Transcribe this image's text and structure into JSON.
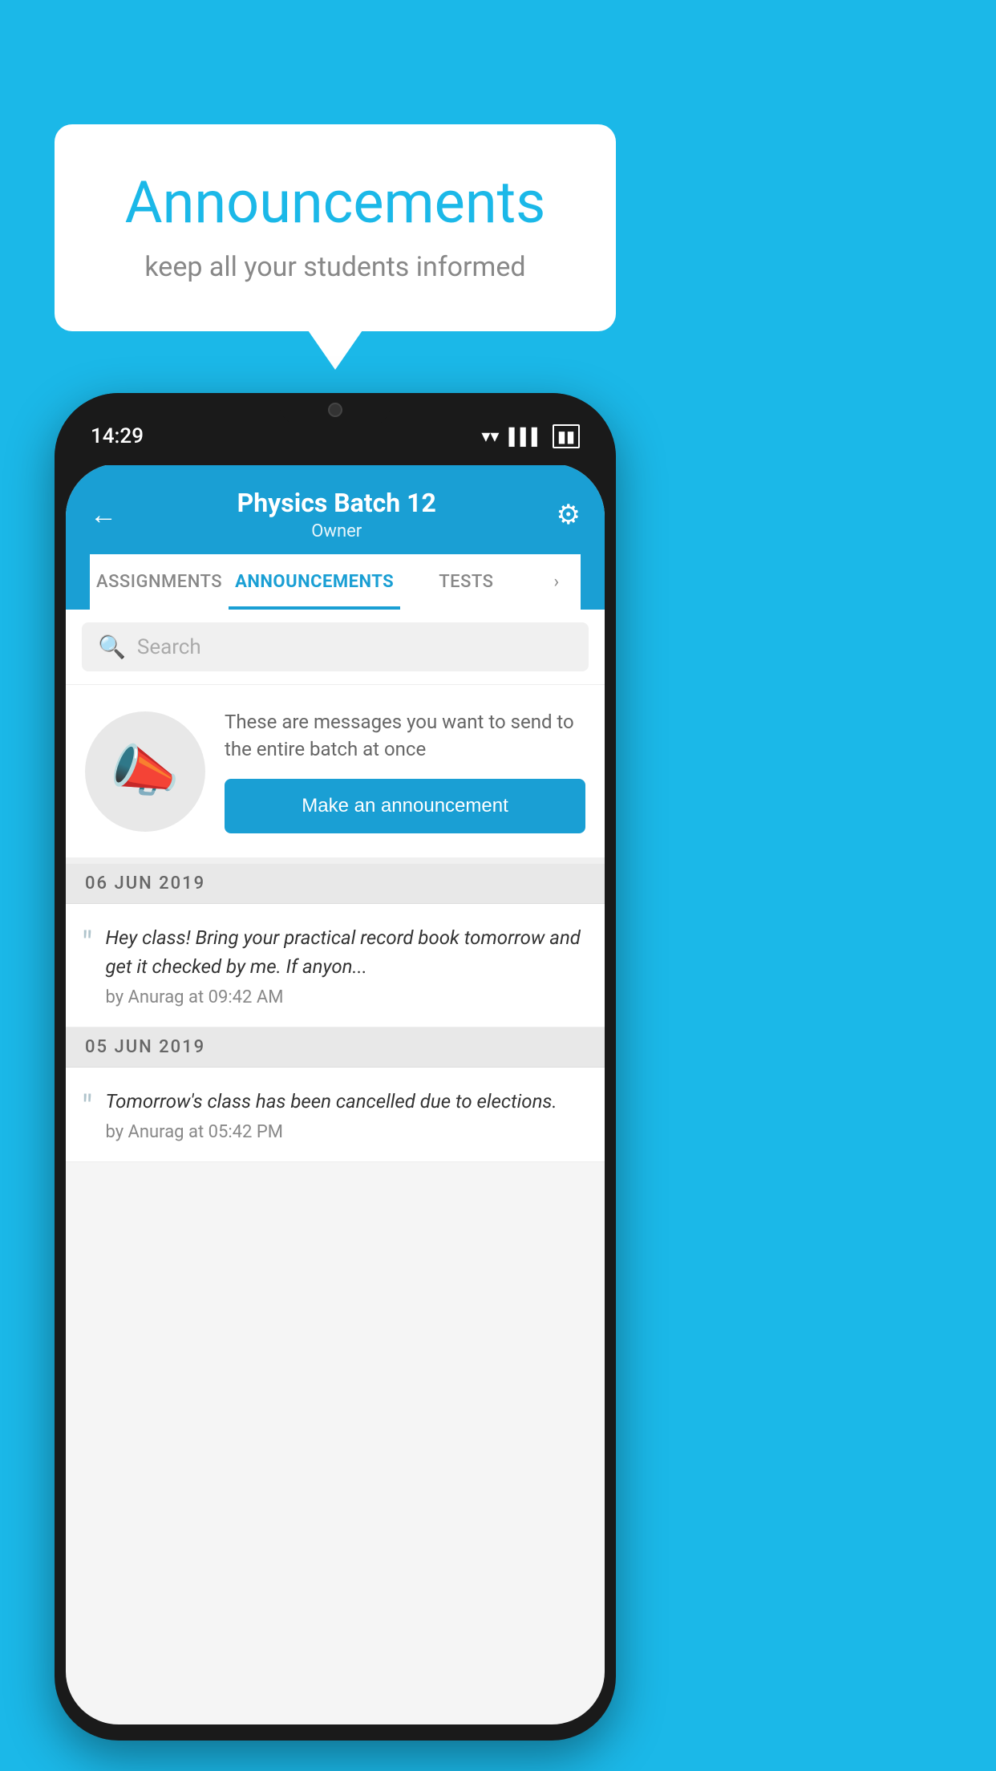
{
  "background": {
    "color": "#1BB8E8"
  },
  "speech_bubble": {
    "title": "Announcements",
    "subtitle": "keep all your students informed"
  },
  "phone": {
    "status_bar": {
      "time": "14:29"
    },
    "header": {
      "title": "Physics Batch 12",
      "subtitle": "Owner",
      "back_label": "←",
      "gear_label": "⚙"
    },
    "tabs": [
      {
        "label": "ASSIGNMENTS",
        "active": false
      },
      {
        "label": "ANNOUNCEMENTS",
        "active": true
      },
      {
        "label": "TESTS",
        "active": false
      }
    ],
    "search": {
      "placeholder": "Search"
    },
    "promo": {
      "icon": "📢",
      "text": "These are messages you want to send to the entire batch at once",
      "button_label": "Make an announcement"
    },
    "announcements": [
      {
        "date": "06  JUN  2019",
        "text": "Hey class! Bring your practical record book tomorrow and get it checked by me. If anyon...",
        "meta": "by Anurag at 09:42 AM"
      },
      {
        "date": "05  JUN  2019",
        "text": "Tomorrow's class has been cancelled due to elections.",
        "meta": "by Anurag at 05:42 PM"
      }
    ]
  }
}
